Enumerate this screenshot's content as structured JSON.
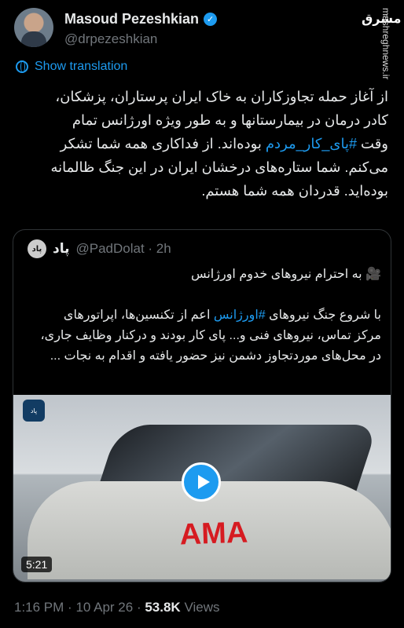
{
  "author": {
    "name": "Masoud Pezeshkian",
    "handle": "@drpezeshkian",
    "verified_icon": "verified-badge-icon"
  },
  "watermark": {
    "logo_text": "مشرق",
    "url": "mashreghnews.ir"
  },
  "translate": {
    "label": "Show translation",
    "icon": "globe-icon"
  },
  "tweet": {
    "line1": "از آغاز حمله تجاوزکاران به خاک ایران پرستاران، پزشکان،",
    "line2": "کادر درمان در بیمارستانها و به طور ویژه اورژانس تمام",
    "line3_prefix": "وقت ",
    "hashtag": "#پای_کار_مردم",
    "line3_suffix": " بوده‌اند. از فداکاری همه شما تشکر",
    "line4": "می‌کنم. شما ستاره‌های درخشان ایران در این جنگ ظالمانه",
    "line5": "بوده‌اید. قدردان همه شما هستم."
  },
  "quote": {
    "avatar_text": "پاد",
    "name": "پاد",
    "handle": "@PadDolat · 2h",
    "title": "🎥 به احترام نیروهای خدوم اورژانس",
    "body_line1": "با شروع جنگ نیروهای ",
    "body_hashtag": "#اورژانس",
    "body_line1_rest": " اعم از تکنسین‌ها، اپراتورهای",
    "body_line2": "مرکز تماس، نیروهای فنی و... پای کار بودند و درکنار وظایف جاری،",
    "body_line3": "در محل‌های موردتجاوز دشمن نیز حضور یافته و اقدام به نجات ...",
    "media": {
      "label": "AMA",
      "duration": "5:21",
      "badge": "پاد",
      "play_icon": "play-icon"
    }
  },
  "meta": {
    "time": "1:16 PM",
    "date": "10 Apr 26",
    "views": "53.8K",
    "views_label": "Views"
  }
}
